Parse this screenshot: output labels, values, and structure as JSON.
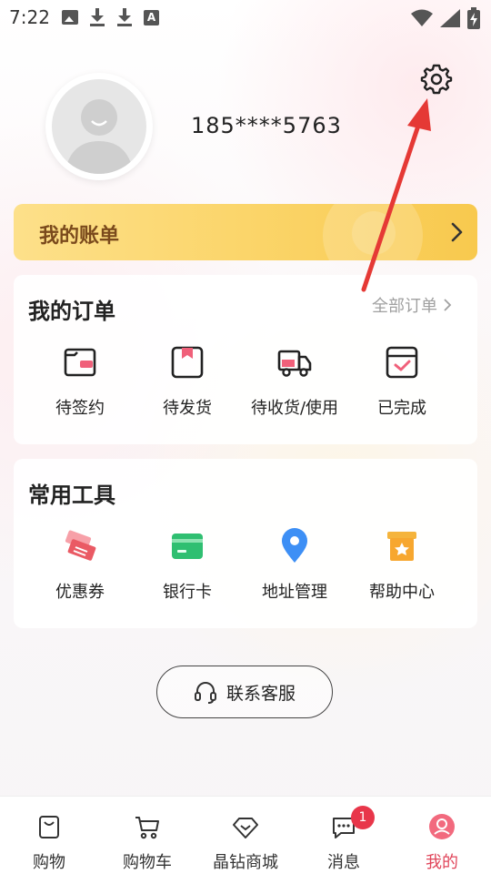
{
  "status_bar": {
    "time": "7:22",
    "left_icons": [
      "image-icon",
      "download-icon",
      "download-icon",
      "a-icon"
    ],
    "right_icons": [
      "wifi-icon",
      "signal-icon",
      "battery-charging-icon"
    ]
  },
  "profile": {
    "phone": "185****5763",
    "avatar_icon": "default-avatar-icon",
    "settings_icon": "gear-icon"
  },
  "bill": {
    "title": "我的账单"
  },
  "orders": {
    "title": "我的订单",
    "all_label": "全部订单",
    "items": [
      {
        "label": "待签约",
        "icon": "contract-icon"
      },
      {
        "label": "待发货",
        "icon": "package-icon"
      },
      {
        "label": "待收货/使用",
        "icon": "truck-icon"
      },
      {
        "label": "已完成",
        "icon": "completed-box-icon"
      }
    ]
  },
  "tools": {
    "title": "常用工具",
    "items": [
      {
        "label": "优惠券",
        "icon": "coupon-icon"
      },
      {
        "label": "银行卡",
        "icon": "bank-card-icon"
      },
      {
        "label": "地址管理",
        "icon": "location-pin-icon"
      },
      {
        "label": "帮助中心",
        "icon": "help-box-icon"
      }
    ]
  },
  "contact": {
    "label": "联系客服",
    "icon": "headset-icon"
  },
  "nav": {
    "items": [
      {
        "label": "购物",
        "icon": "shopping-bag-icon"
      },
      {
        "label": "购物车",
        "icon": "cart-icon"
      },
      {
        "label": "晶钻商城",
        "icon": "diamond-icon"
      },
      {
        "label": "消息",
        "icon": "message-icon",
        "badge": "1"
      },
      {
        "label": "我的",
        "icon": "profile-icon"
      }
    ],
    "active": "我的"
  },
  "colors": {
    "accent": "#e0455a",
    "bill_gold": "#f8c94e",
    "bill_text": "#7a4a1c",
    "annotation_arrow": "#e53935"
  }
}
